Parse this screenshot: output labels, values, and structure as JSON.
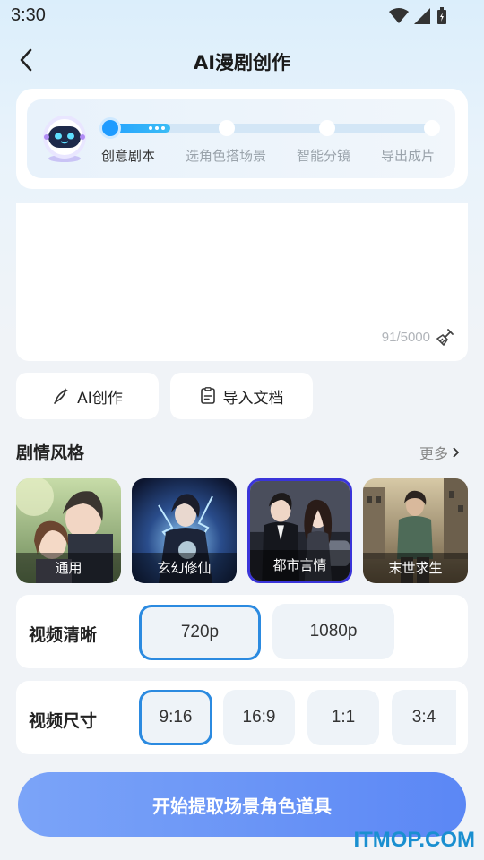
{
  "status_bar": {
    "time": "3:30"
  },
  "nav": {
    "title": "AI漫剧创作"
  },
  "steps": {
    "progress": 0.19,
    "items": [
      {
        "label": "创意剧本",
        "active": true
      },
      {
        "label": "选角色搭场景",
        "active": false
      },
      {
        "label": "智能分镜",
        "active": false
      },
      {
        "label": "导出成片",
        "active": false
      }
    ]
  },
  "editor": {
    "char_count": "91/5000"
  },
  "actions": {
    "ai_create": "AI创作",
    "import_doc": "导入文档"
  },
  "style_section": {
    "title": "剧情风格",
    "more": "更多",
    "items": [
      {
        "label": "通用",
        "selected": false
      },
      {
        "label": "玄幻修仙",
        "selected": false
      },
      {
        "label": "都市言情",
        "selected": true
      },
      {
        "label": "末世求生",
        "selected": false
      }
    ]
  },
  "video_quality": {
    "label": "视频清晰",
    "options": [
      {
        "label": "720p",
        "selected": true
      },
      {
        "label": "1080p",
        "selected": false
      }
    ]
  },
  "video_size": {
    "label": "视频尺寸",
    "options": [
      {
        "label": "9:16",
        "selected": true
      },
      {
        "label": "16:9",
        "selected": false
      },
      {
        "label": "1:1",
        "selected": false
      },
      {
        "label": "3:4",
        "selected": false
      }
    ]
  },
  "primary_button": {
    "label": "开始提取场景角色道具"
  },
  "watermark": "ITMOP.COM",
  "colors": {
    "accent": "#1e9bff",
    "selected_border": "#2b8ae0",
    "style_selected": "#3a34d9",
    "button": "#6a95f6"
  }
}
